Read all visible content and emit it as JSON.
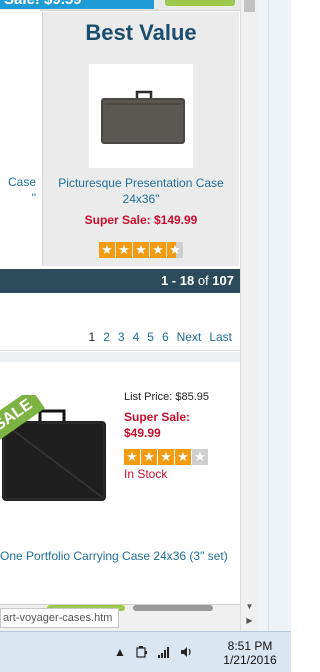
{
  "top": {
    "sale_text": "Sale! $9.59"
  },
  "left_product": {
    "name_line1": "Case",
    "name_line2": "\""
  },
  "best_value": {
    "title": "Best Value",
    "image_icon": "portfolio-case-icon",
    "name": "Picturesque Presentation Case 24x36\"",
    "price": "Super Sale: $149.99",
    "rating": 4.5
  },
  "results": {
    "range": "1 - 18",
    "of_label": "of",
    "total": "107"
  },
  "pagination": {
    "pages": [
      "1",
      "2",
      "3",
      "4",
      "5",
      "6"
    ],
    "current": "1",
    "next": "Next",
    "last": "Last"
  },
  "product2": {
    "badge": "SALE",
    "list_price": "List Price: $85.95",
    "sale_label": "Super Sale:",
    "sale_price": "$49.99",
    "rating": 4,
    "stock": "In Stock",
    "name": "One Portfolio Carrying Case 24x36 (3\" set)"
  },
  "status": {
    "url": "art-voyager-cases.htm"
  },
  "taskbar": {
    "time": "8:51 PM",
    "date": "1/21/2016",
    "icons": [
      "show-hidden-icons-icon",
      "power-icon",
      "network-signal-icon",
      "volume-icon"
    ]
  },
  "colors": {
    "accent": "#1f9bd6",
    "price_red": "#c8102e",
    "bar_dark": "#2b4a5c",
    "star": "#f39c12"
  }
}
